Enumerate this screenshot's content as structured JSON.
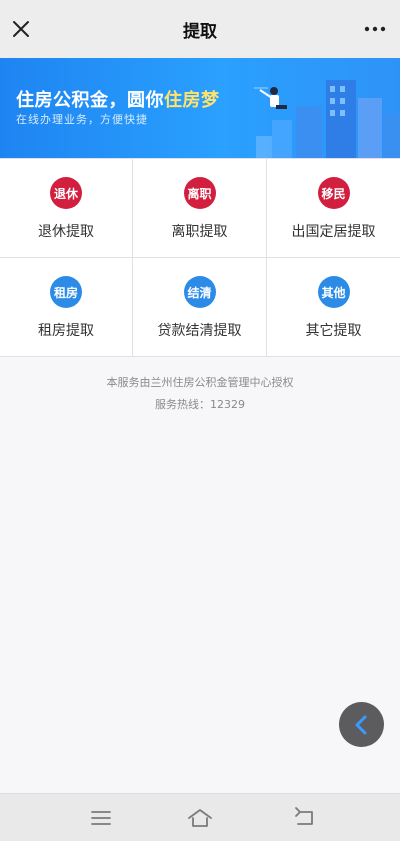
{
  "nav": {
    "title": "提取",
    "close_icon": "close-icon",
    "more_icon": "more-icon"
  },
  "banner": {
    "slogan_main": "住房公积金，圆你",
    "slogan_highlight": "住房梦",
    "subtitle": "在线办理业务，方便快捷",
    "colors": {
      "background": "#1e84f1",
      "highlight": "#ffe36b"
    }
  },
  "services": [
    {
      "badge": "退休",
      "label": "退休提取",
      "color": "#d31f3f"
    },
    {
      "badge": "离职",
      "label": "离职提取",
      "color": "#d31f3f"
    },
    {
      "badge": "移民",
      "label": "出国定居提取",
      "color": "#d31f3f"
    },
    {
      "badge": "租房",
      "label": "租房提取",
      "color": "#2d8be8"
    },
    {
      "badge": "结清",
      "label": "贷款结清提取",
      "color": "#2d8be8"
    },
    {
      "badge": "其他",
      "label": "其它提取",
      "color": "#2d8be8"
    }
  ],
  "footer": {
    "authorization": "本服务由兰州住房公积金管理中心授权",
    "hotline": "服务热线：12329"
  },
  "fab": {
    "icon": "chevron-left-icon"
  },
  "system_bar": {
    "icons": [
      "menu-icon",
      "home-icon",
      "back-icon"
    ]
  }
}
